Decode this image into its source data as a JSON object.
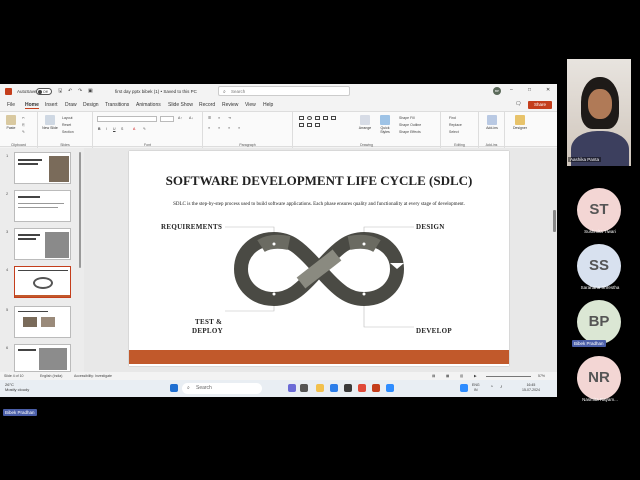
{
  "titlebar": {
    "autosave_label": "AutoSave",
    "autosave_state": "Off",
    "document_title": "first day pptx bibek (1) • Saved to this PC",
    "search_placeholder": "Search",
    "account_initials": "BP"
  },
  "tabs": [
    "File",
    "Home",
    "Insert",
    "Draw",
    "Design",
    "Transitions",
    "Animations",
    "Slide Show",
    "Record",
    "Review",
    "View",
    "Help"
  ],
  "active_tab": "Home",
  "share_label": "Share",
  "ribbon": {
    "clipboard": {
      "paste": "Paste",
      "group": "Clipboard"
    },
    "slides": {
      "new_slide": "New Slide",
      "layout": "Layout",
      "reset": "Reset",
      "section": "Section",
      "group": "Slides"
    },
    "font": {
      "group": "Font"
    },
    "paragraph": {
      "group": "Paragraph"
    },
    "drawing": {
      "arrange": "Arrange",
      "quick_styles": "Quick Styles",
      "shape_fill": "Shape Fill",
      "shape_outline": "Shape Outline",
      "shape_effects": "Shape Effects",
      "group": "Drawing"
    },
    "editing": {
      "find": "Find",
      "replace": "Replace",
      "select": "Select",
      "group": "Editing"
    },
    "addins": {
      "addins": "Add-ins",
      "group": "Add-ins"
    },
    "designer": {
      "label": "Designer"
    }
  },
  "thumbnails": [
    {
      "num": "1"
    },
    {
      "num": "2"
    },
    {
      "num": "3"
    },
    {
      "num": "4"
    },
    {
      "num": "5"
    },
    {
      "num": "6"
    }
  ],
  "selected_thumbnail": "4",
  "slide": {
    "title": "SOFTWARE DEVELOPMENT LIFE CYCLE (SDLC)",
    "description": "SDLC is the step-by-step process used to build software applications. Each phase ensures quality and functionality at every stage of development.",
    "labels": {
      "requirements": "REQUIREMENTS",
      "design": "DESIGN",
      "test_line1": "TEST &",
      "test_line2": "DEPLOY",
      "develop": "DEVELOP"
    },
    "accent_color": "#c1592b",
    "loop_colors": [
      "#4a4a44",
      "#6b6b62",
      "#8a8a80"
    ]
  },
  "statusbar": {
    "slide_info": "Slide 4 of 10",
    "language": "English (India)",
    "accessibility": "Accessibility: Investigate",
    "zoom": "57%"
  },
  "taskbar": {
    "temperature": "26°C",
    "weather": "Mostly cloudy",
    "search_placeholder": "Search",
    "language_line1": "ENG",
    "language_line2": "IN",
    "time": "16:45",
    "date": "15-07-2024"
  },
  "participants": {
    "camera_name": "Aashika Panta",
    "list": [
      {
        "initials": "ST",
        "name": "Sushmita Tiwari",
        "color": "#f3d6d4"
      },
      {
        "initials": "SS",
        "name": "Sarahana Shrestha",
        "color": "#d8e1ef"
      },
      {
        "initials": "BP",
        "name": "Bibek Pradhan",
        "color": "#dbe7d4"
      },
      {
        "initials": "NR",
        "name": "Nasmita Rayam...",
        "color": "#f3d6d4"
      }
    ],
    "bp_badge": "Bibek Pradhan",
    "bottom_badge": "Bibek Pradhan"
  }
}
